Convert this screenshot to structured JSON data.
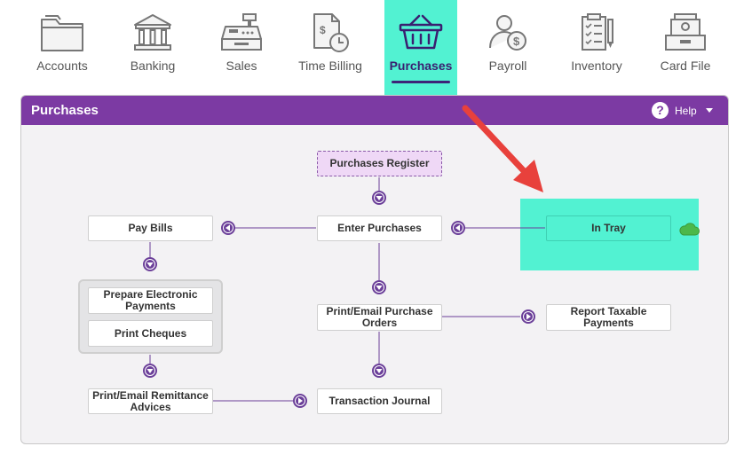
{
  "nav": {
    "items": [
      {
        "label": "Accounts",
        "icon": "folder-icon"
      },
      {
        "label": "Banking",
        "icon": "bank-icon"
      },
      {
        "label": "Sales",
        "icon": "cash-register-icon"
      },
      {
        "label": "Time Billing",
        "icon": "document-clock-icon"
      },
      {
        "label": "Purchases",
        "icon": "basket-icon",
        "active": true
      },
      {
        "label": "Payroll",
        "icon": "person-dollar-icon"
      },
      {
        "label": "Inventory",
        "icon": "clipboard-checklist-icon"
      },
      {
        "label": "Card File",
        "icon": "card-file-icon"
      }
    ]
  },
  "panel": {
    "title": "Purchases",
    "help_label": "Help",
    "help_glyph": "?"
  },
  "flow": {
    "purchases_register": "Purchases Register",
    "enter_purchases": "Enter Purchases",
    "pay_bills": "Pay Bills",
    "in_tray": "In Tray",
    "prepare_electronic_payments": "Prepare Electronic Payments",
    "print_cheques": "Print Cheques",
    "print_email_purchase_orders": "Print/Email Purchase Orders",
    "report_taxable_payments": "Report Taxable Payments",
    "print_email_remittance_advices": "Print/Email Remittance Advices",
    "transaction_journal": "Transaction Journal"
  },
  "colors": {
    "brand_purple": "#7c3aa3",
    "highlight_teal": "#52f2d2",
    "annotation_red": "#e8413c",
    "connector_purple": "#6b3f99"
  }
}
